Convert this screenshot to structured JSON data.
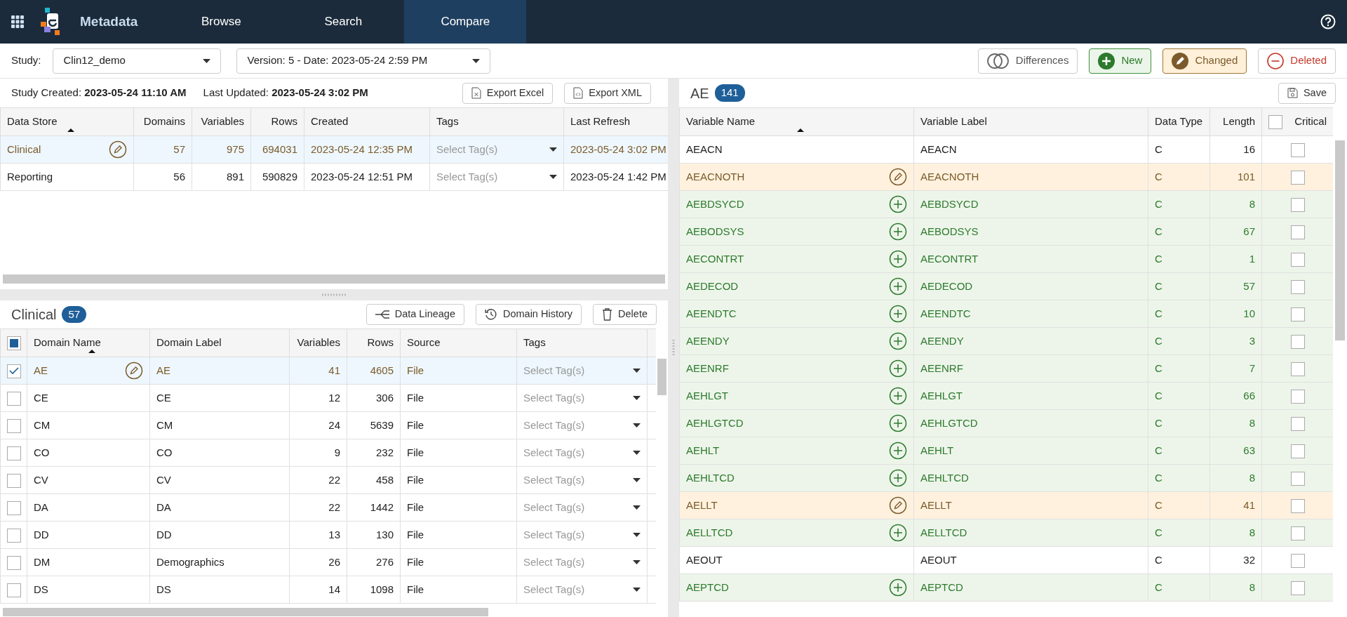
{
  "app": {
    "title": "Metadata",
    "nav": [
      {
        "label": "Browse",
        "selected": false
      },
      {
        "label": "Search",
        "selected": false
      },
      {
        "label": "Compare",
        "selected": true
      }
    ]
  },
  "toolbar": {
    "study_label": "Study:",
    "study": "Clin12_demo",
    "version": "Version: 5 - Date: 2023-05-24 2:59 PM",
    "filters": [
      {
        "kind": "differences",
        "label": "Differences"
      },
      {
        "kind": "new",
        "label": "New"
      },
      {
        "kind": "changed",
        "label": "Changed"
      },
      {
        "kind": "deleted",
        "label": "Deleted"
      }
    ]
  },
  "study_info": {
    "created_label": "Study Created:",
    "created": "2023-05-24 11:10 AM",
    "updated_label": "Last Updated:",
    "updated": "2023-05-24 3:02 PM",
    "buttons": [
      {
        "kind": "excel",
        "label": "Export Excel"
      },
      {
        "kind": "xml",
        "label": "Export XML"
      }
    ]
  },
  "data_stores": {
    "columns": [
      "Data Store",
      "Domains",
      "Variables",
      "Rows",
      "Created",
      "Tags",
      "Last Refresh"
    ],
    "rows": [
      {
        "name": "Clinical",
        "kind": "changed",
        "selected": true,
        "domains": "57",
        "variables": "975",
        "rows": "694031",
        "created": "2023-05-24 12:35 PM",
        "tags_placeholder": "Select Tag(s)",
        "last_refresh": "2023-05-24 3:02 PM"
      },
      {
        "name": "Reporting",
        "kind": "unchanged",
        "selected": false,
        "domains": "56",
        "variables": "891",
        "rows": "590829",
        "created": "2023-05-24 12:51 PM",
        "tags_placeholder": "Select Tag(s)",
        "last_refresh": "2023-05-24 1:42 PM"
      }
    ]
  },
  "domains": {
    "title": "Clinical",
    "count": "57",
    "buttons": [
      {
        "kind": "lineage",
        "label": "Data Lineage"
      },
      {
        "kind": "history",
        "label": "Domain History"
      },
      {
        "kind": "delete",
        "label": "Delete"
      }
    ],
    "header_some_checked": true,
    "columns": [
      "Domain Name",
      "Domain Label",
      "Variables",
      "Rows",
      "Source",
      "Tags"
    ],
    "rows": [
      {
        "name": "AE",
        "label": "AE",
        "variables": "41",
        "rows": "4605",
        "source": "File",
        "tags_placeholder": "Select Tag(s)",
        "kind": "changed",
        "selected": true,
        "checked": true
      },
      {
        "name": "CE",
        "label": "CE",
        "variables": "12",
        "rows": "306",
        "source": "File",
        "tags_placeholder": "Select Tag(s)",
        "kind": "unchanged",
        "selected": false,
        "checked": false
      },
      {
        "name": "CM",
        "label": "CM",
        "variables": "24",
        "rows": "5639",
        "source": "File",
        "tags_placeholder": "Select Tag(s)",
        "kind": "unchanged",
        "selected": false,
        "checked": false
      },
      {
        "name": "CO",
        "label": "CO",
        "variables": "9",
        "rows": "232",
        "source": "File",
        "tags_placeholder": "Select Tag(s)",
        "kind": "unchanged",
        "selected": false,
        "checked": false
      },
      {
        "name": "CV",
        "label": "CV",
        "variables": "22",
        "rows": "458",
        "source": "File",
        "tags_placeholder": "Select Tag(s)",
        "kind": "unchanged",
        "selected": false,
        "checked": false
      },
      {
        "name": "DA",
        "label": "DA",
        "variables": "22",
        "rows": "1442",
        "source": "File",
        "tags_placeholder": "Select Tag(s)",
        "kind": "unchanged",
        "selected": false,
        "checked": false
      },
      {
        "name": "DD",
        "label": "DD",
        "variables": "13",
        "rows": "130",
        "source": "File",
        "tags_placeholder": "Select Tag(s)",
        "kind": "unchanged",
        "selected": false,
        "checked": false
      },
      {
        "name": "DM",
        "label": "Demographics",
        "variables": "26",
        "rows": "276",
        "source": "File",
        "tags_placeholder": "Select Tag(s)",
        "kind": "unchanged",
        "selected": false,
        "checked": false
      },
      {
        "name": "DS",
        "label": "DS",
        "variables": "14",
        "rows": "1098",
        "source": "File",
        "tags_placeholder": "Select Tag(s)",
        "kind": "unchanged",
        "selected": false,
        "checked": false
      }
    ]
  },
  "variables": {
    "title": "AE",
    "count": "141",
    "save": "Save",
    "columns": [
      "Variable Name",
      "Variable Label",
      "Data Type",
      "Length",
      "Critical"
    ],
    "critical_all": false,
    "rows": [
      {
        "name": "AEACN",
        "label": "AEACN",
        "type": "C",
        "length": "16",
        "kind": "unchanged",
        "critical": false
      },
      {
        "name": "AEACNOTH",
        "label": "AEACNOTH",
        "type": "C",
        "length": "101",
        "kind": "changed",
        "critical": false
      },
      {
        "name": "AEBDSYCD",
        "label": "AEBDSYCD",
        "type": "C",
        "length": "8",
        "kind": "new",
        "critical": false
      },
      {
        "name": "AEBODSYS",
        "label": "AEBODSYS",
        "type": "C",
        "length": "67",
        "kind": "new",
        "critical": false
      },
      {
        "name": "AECONTRT",
        "label": "AECONTRT",
        "type": "C",
        "length": "1",
        "kind": "new",
        "critical": false
      },
      {
        "name": "AEDECOD",
        "label": "AEDECOD",
        "type": "C",
        "length": "57",
        "kind": "new",
        "critical": false
      },
      {
        "name": "AEENDTC",
        "label": "AEENDTC",
        "type": "C",
        "length": "10",
        "kind": "new",
        "critical": false
      },
      {
        "name": "AEENDY",
        "label": "AEENDY",
        "type": "C",
        "length": "3",
        "kind": "new",
        "critical": false
      },
      {
        "name": "AEENRF",
        "label": "AEENRF",
        "type": "C",
        "length": "7",
        "kind": "new",
        "critical": false
      },
      {
        "name": "AEHLGT",
        "label": "AEHLGT",
        "type": "C",
        "length": "66",
        "kind": "new",
        "critical": false
      },
      {
        "name": "AEHLGTCD",
        "label": "AEHLGTCD",
        "type": "C",
        "length": "8",
        "kind": "new",
        "critical": false
      },
      {
        "name": "AEHLT",
        "label": "AEHLT",
        "type": "C",
        "length": "63",
        "kind": "new",
        "critical": false
      },
      {
        "name": "AEHLTCD",
        "label": "AEHLTCD",
        "type": "C",
        "length": "8",
        "kind": "new",
        "critical": false
      },
      {
        "name": "AELLT",
        "label": "AELLT",
        "type": "C",
        "length": "41",
        "kind": "changed",
        "critical": false
      },
      {
        "name": "AELLTCD",
        "label": "AELLTCD",
        "type": "C",
        "length": "8",
        "kind": "new",
        "critical": false
      },
      {
        "name": "AEOUT",
        "label": "AEOUT",
        "type": "C",
        "length": "32",
        "kind": "unchanged",
        "critical": false
      },
      {
        "name": "AEPTCD",
        "label": "AEPTCD",
        "type": "C",
        "length": "8",
        "kind": "new",
        "critical": false
      }
    ]
  }
}
